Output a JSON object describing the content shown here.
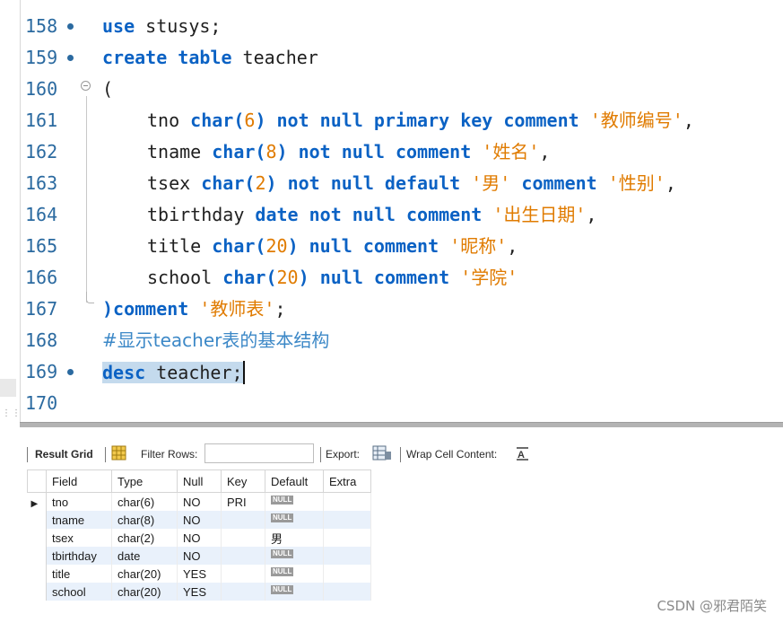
{
  "editor": {
    "lines": [
      {
        "number": "158",
        "tokens": [
          "use",
          " stusys;"
        ]
      },
      {
        "number": "159",
        "tokens": [
          "create table",
          " teacher"
        ]
      },
      {
        "number": "160",
        "tokens": [
          "("
        ]
      },
      {
        "number": "161",
        "tokens": [
          "tno ",
          "char(",
          "6",
          ") not null primary key comment ",
          "'教师编号'",
          ","
        ]
      },
      {
        "number": "162",
        "tokens": [
          "tname ",
          "char(",
          "8",
          ") not null comment ",
          "'姓名'",
          ","
        ]
      },
      {
        "number": "163",
        "tokens": [
          "tsex ",
          "char(",
          "2",
          ") not null default ",
          "'男'",
          " comment ",
          "'性别'",
          ","
        ]
      },
      {
        "number": "164",
        "tokens": [
          "tbirthday ",
          "date not null comment ",
          "'出生日期'",
          ","
        ]
      },
      {
        "number": "165",
        "tokens": [
          "title ",
          "char(",
          "20",
          ") null comment ",
          "'昵称'",
          ","
        ]
      },
      {
        "number": "166",
        "tokens": [
          "school ",
          "char(",
          "20",
          ") null comment ",
          "'学院'"
        ]
      },
      {
        "number": "167",
        "tokens": [
          ")comment ",
          "'教师表'",
          ";"
        ]
      },
      {
        "number": "168",
        "tokens": [
          "#显示teacher表的基本结构"
        ]
      },
      {
        "number": "169",
        "tokens": [
          "desc",
          " teacher;"
        ]
      },
      {
        "number": "170",
        "tokens": []
      }
    ]
  },
  "toolbar": {
    "result_grid": "Result Grid",
    "filter_rows": "Filter Rows:",
    "filter_value": "",
    "export": "Export:",
    "wrap_cell": "Wrap Cell Content:"
  },
  "grid": {
    "columns": [
      "Field",
      "Type",
      "Null",
      "Key",
      "Default",
      "Extra"
    ],
    "rows": [
      {
        "field": "tno",
        "type": "char(6)",
        "null": "NO",
        "key": "PRI",
        "default": "NULL",
        "extra": ""
      },
      {
        "field": "tname",
        "type": "char(8)",
        "null": "NO",
        "key": "",
        "default": "NULL",
        "extra": ""
      },
      {
        "field": "tsex",
        "type": "char(2)",
        "null": "NO",
        "key": "",
        "default": "男",
        "extra": ""
      },
      {
        "field": "tbirthday",
        "type": "date",
        "null": "NO",
        "key": "",
        "default": "NULL",
        "extra": ""
      },
      {
        "field": "title",
        "type": "char(20)",
        "null": "YES",
        "key": "",
        "default": "NULL",
        "extra": ""
      },
      {
        "field": "school",
        "type": "char(20)",
        "null": "YES",
        "key": "",
        "default": "NULL",
        "extra": ""
      }
    ]
  },
  "watermark": "CSDN @邪君陌笑",
  "colors": {
    "keyword": "#0b62c4",
    "string": "#e07b00",
    "comment": "#3c88c7",
    "line_number": "#2b6aa0",
    "selection": "#c4daed"
  }
}
